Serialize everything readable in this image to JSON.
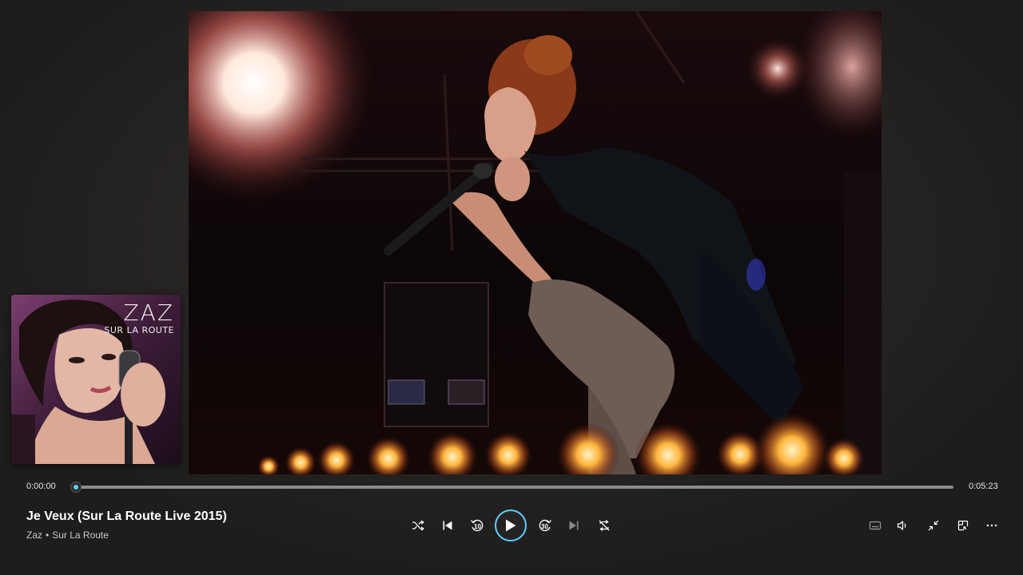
{
  "playback": {
    "current_time": "0:00:00",
    "total_time": "0:05:23",
    "progress": 0
  },
  "track": {
    "title": "Je Veux (Sur La Route Live 2015)",
    "artist": "Zaz",
    "separator": "•",
    "album": "Sur La Route"
  },
  "album_art": {
    "title_text": "ZAZ",
    "subtitle_text": "SUR LA ROUTE"
  },
  "controls": {
    "shuffle_icon": "shuffle-icon",
    "previous_icon": "previous-icon",
    "rewind_seconds": "10",
    "play_icon": "play-icon",
    "forward_seconds": "30",
    "next_icon": "next-icon",
    "repeat_icon": "repeat-off-icon",
    "right_icons": [
      "captions-icon",
      "volume-icon",
      "exit-full-screen-icon",
      "mini-player-icon",
      "more-icon"
    ]
  },
  "colors": {
    "accent": "#60cdff",
    "background": "#1f1e1d",
    "text_primary": "#ffffff",
    "text_secondary": "#c9c9c9"
  }
}
